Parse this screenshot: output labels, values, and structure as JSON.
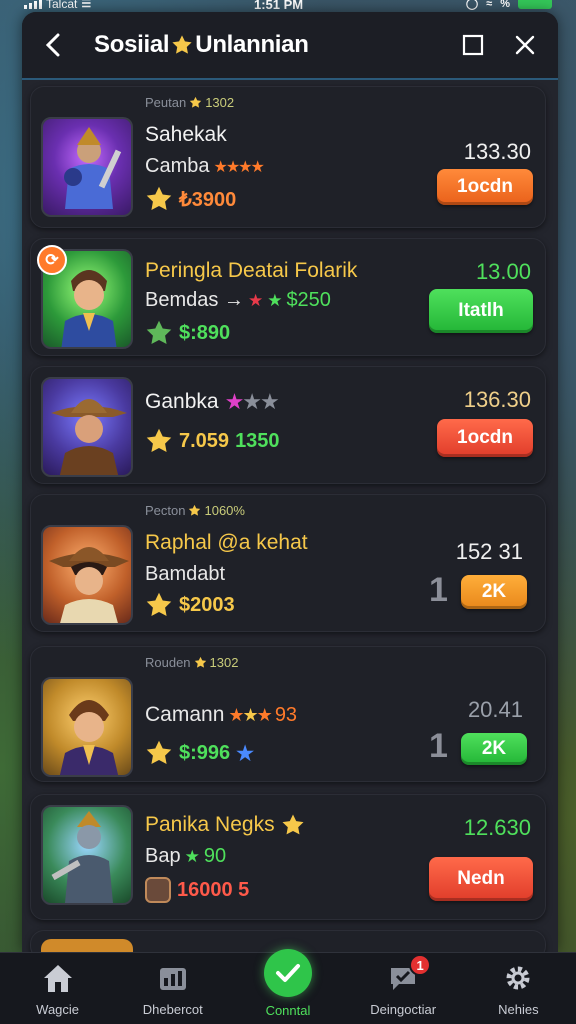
{
  "status_bar": {
    "carrier": "Talcat",
    "time": "1:51 PM",
    "battery_pct": 80
  },
  "header": {
    "title_part1": "Sosiial ",
    "title_part2": "Unlannian"
  },
  "cards": [
    {
      "topline": "Peutan",
      "topline_pct": "1302",
      "name": "Sahekak",
      "sub": "Camba",
      "amount": "₺3900",
      "price": "133.30",
      "button": "1ocdn",
      "stars": 4
    },
    {
      "name": "Peringla Deatai Folarik",
      "sub": "Bemdas →",
      "sub_value": "$250",
      "amount": "$:890",
      "price": "13.00",
      "button": "Itatlh"
    },
    {
      "name": "Ganbka",
      "amount": "7.059",
      "amount2": "1350",
      "price": "136.30",
      "button": "1ocdn"
    },
    {
      "topline": "Pecton",
      "topline_pct": "1060%",
      "name": "Raphal @a kehat",
      "sub": "Bamdabt",
      "amount": "$2003",
      "price": "152 31",
      "button": "2K",
      "big": "1"
    },
    {
      "topline": "Rouden",
      "topline_pct": "1302",
      "name": "Camann",
      "sub_value": "93",
      "amount": "$:996",
      "price": "20.41",
      "button": "2K",
      "big": "1"
    },
    {
      "name": "Panika Negks",
      "sub": "Bap",
      "sub_value": "90",
      "amount": "16000 5",
      "price": "12.630",
      "button": "Nedn"
    }
  ],
  "tabs": [
    {
      "label": "Wagcie",
      "icon": "home-icon"
    },
    {
      "label": "Dhebercot",
      "icon": "chart-icon"
    },
    {
      "label": "Conntal",
      "icon": "check-icon"
    },
    {
      "label": "Deingoctiar",
      "icon": "chat-icon",
      "badge": "1"
    },
    {
      "label": "Nehies",
      "icon": "gear-icon"
    }
  ],
  "colors": {
    "panel": "#23252d",
    "card": "#1f2128",
    "gold": "#f6c84a",
    "green": "#4fe05c",
    "orange": "#e9601a",
    "red": "#e03c2a"
  }
}
